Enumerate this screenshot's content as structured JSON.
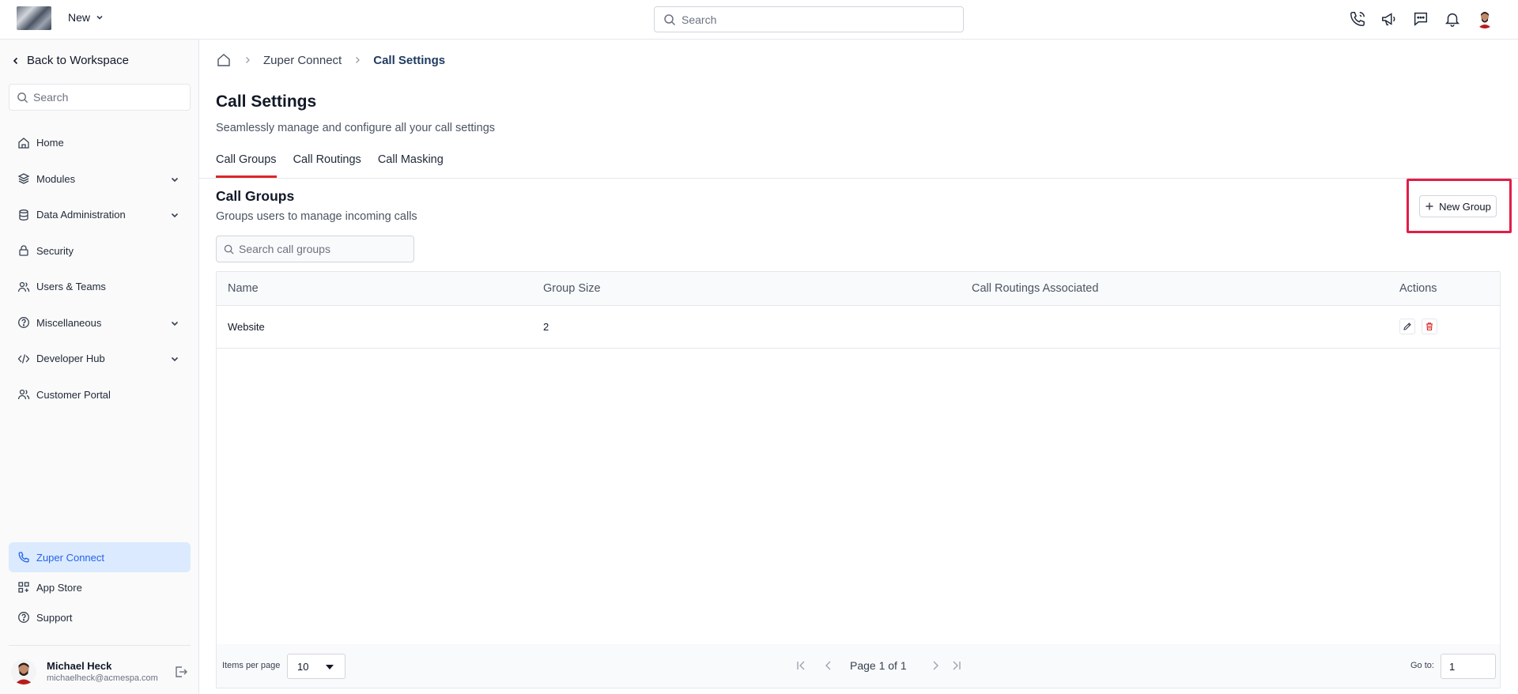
{
  "topbar": {
    "new_label": "New",
    "search_placeholder": "Search",
    "icons": [
      "phone-icon",
      "megaphone-icon",
      "chat-icon",
      "bell-icon",
      "user-avatar"
    ]
  },
  "sidebar": {
    "back_label": "Back to Workspace",
    "search_placeholder": "Search",
    "items": [
      {
        "label": "Home",
        "icon": "home-icon"
      },
      {
        "label": "Modules",
        "icon": "layers-icon",
        "expandable": true
      },
      {
        "label": "Data Administration",
        "icon": "database-icon",
        "expandable": true
      },
      {
        "label": "Security",
        "icon": "lock-icon"
      },
      {
        "label": "Users & Teams",
        "icon": "users-icon"
      },
      {
        "label": "Miscellaneous",
        "icon": "help-circle-icon",
        "expandable": true
      },
      {
        "label": "Developer Hub",
        "icon": "code-icon",
        "expandable": true
      },
      {
        "label": "Customer Portal",
        "icon": "users-icon"
      }
    ],
    "bottom_items": [
      {
        "label": "Zuper Connect",
        "icon": "phone-icon",
        "active": true
      },
      {
        "label": "App Store",
        "icon": "grid-icon"
      },
      {
        "label": "Support",
        "icon": "help-circle-icon"
      }
    ],
    "user": {
      "name": "Michael Heck",
      "email": "michaelheck@acmespa.com"
    }
  },
  "breadcrumb": {
    "items": [
      "Zuper Connect",
      "Call Settings"
    ]
  },
  "page": {
    "title": "Call Settings",
    "subtitle": "Seamlessly manage and configure all your call settings",
    "tabs": [
      {
        "label": "Call Groups",
        "active": true
      },
      {
        "label": "Call Routings"
      },
      {
        "label": "Call Masking"
      }
    ]
  },
  "section": {
    "title": "Call Groups",
    "subtitle": "Groups users to manage incoming calls",
    "new_group_label": "New Group",
    "search_placeholder": "Search call groups"
  },
  "table": {
    "headers": [
      "Name",
      "Group Size",
      "Call Routings Associated",
      "Actions"
    ],
    "rows": [
      {
        "name": "Website",
        "group_size": "2",
        "call_routings": ""
      }
    ]
  },
  "footer": {
    "items_per_page_label": "Items per page",
    "items_per_page_value": "10",
    "page_text": "Page 1 of 1",
    "goto_label": "Go to:",
    "goto_value": "1"
  },
  "colors": {
    "accent_active_tab": "#dc2626",
    "highlight_box": "#e11d48",
    "active_nav_bg": "#dbeafe",
    "active_nav_text": "#2563eb",
    "delete_icon": "#dc2626"
  }
}
